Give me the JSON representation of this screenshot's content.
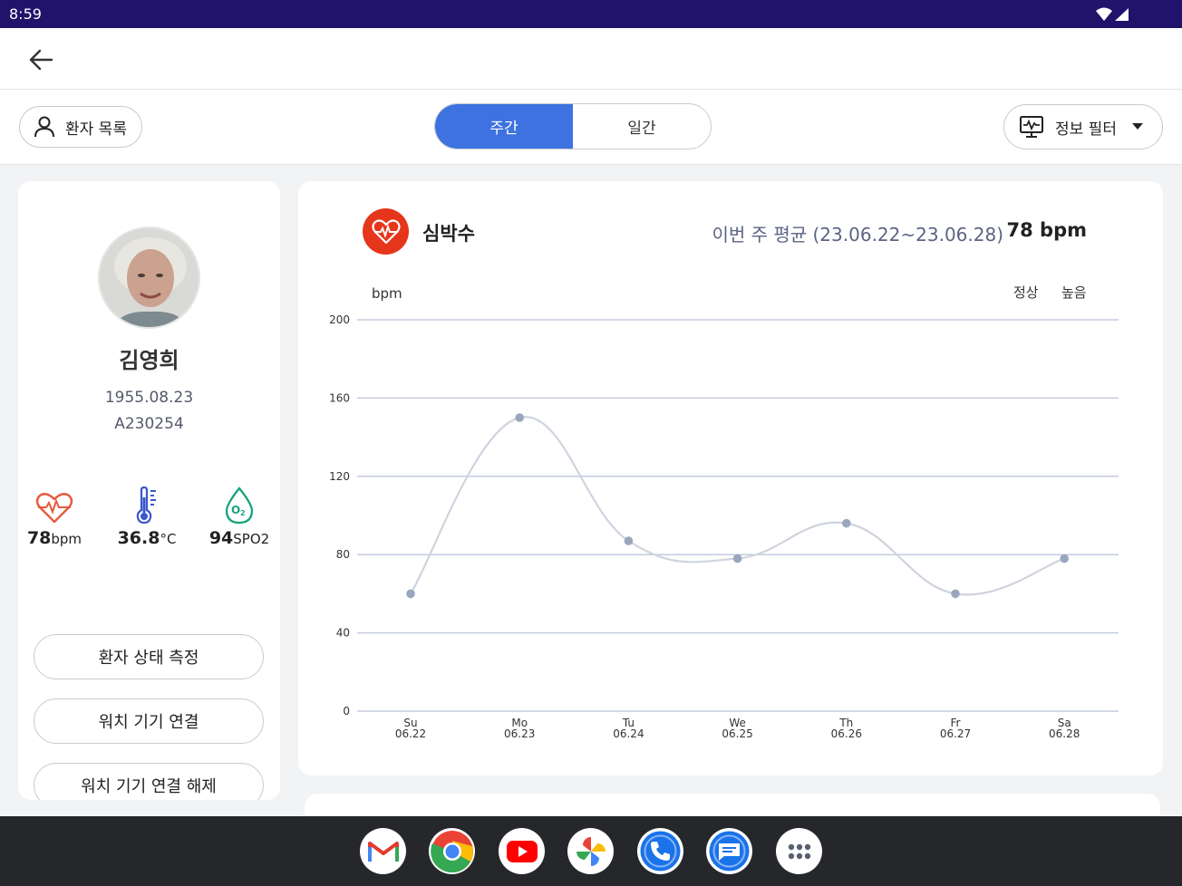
{
  "status_bar": {
    "time": "8:59"
  },
  "toolbar": {
    "patients_label": "환자 목록",
    "tabs": [
      {
        "label": "주간",
        "active": true
      },
      {
        "label": "일간",
        "active": false
      }
    ],
    "filter_label": "정보 필터"
  },
  "patient": {
    "name": "김영희",
    "dob": "1955.08.23",
    "id": "A230254",
    "vitals": [
      {
        "value": "78",
        "unit": "bpm",
        "icon": "heart-rate-icon"
      },
      {
        "value": "36.8",
        "unit": "°C",
        "icon": "thermometer-icon"
      },
      {
        "value": "94",
        "unit": "SPO2",
        "icon": "oxygen-drop-icon"
      }
    ],
    "actions": [
      "환자 상태 측정",
      "워치 기기 연결",
      "워치 기기 연결 해제"
    ]
  },
  "heart_card": {
    "title": "심박수",
    "avg_label": "이번 주 평균 (23.06.22~23.06.28)",
    "avg_value": "78 bpm"
  },
  "chart_data": {
    "type": "line",
    "ylabel": "bpm",
    "ylim": [
      0,
      200
    ],
    "yticks": [
      "200",
      "160",
      "120",
      "80",
      "40",
      "0"
    ],
    "legend": [
      "정상",
      "높음"
    ],
    "legend_position": "top-right",
    "grid": true,
    "categories": [
      {
        "day": "Su",
        "date": "06.22"
      },
      {
        "day": "Mo",
        "date": "06.23"
      },
      {
        "day": "Tu",
        "date": "06.24"
      },
      {
        "day": "We",
        "date": "06.25"
      },
      {
        "day": "Th",
        "date": "06.26"
      },
      {
        "day": "Fr",
        "date": "06.27"
      },
      {
        "day": "Sa",
        "date": "06.28"
      }
    ],
    "values": [
      60,
      150,
      87,
      78,
      96,
      60,
      78
    ],
    "line_color": "#cfd4de",
    "point_color": "#9aa6bd",
    "grid_color": "#c5cbe0"
  },
  "dock": {
    "apps": [
      "gmail-icon",
      "chrome-icon",
      "youtube-icon",
      "photos-icon",
      "phone-icon",
      "messages-icon",
      "app-drawer-icon"
    ]
  }
}
